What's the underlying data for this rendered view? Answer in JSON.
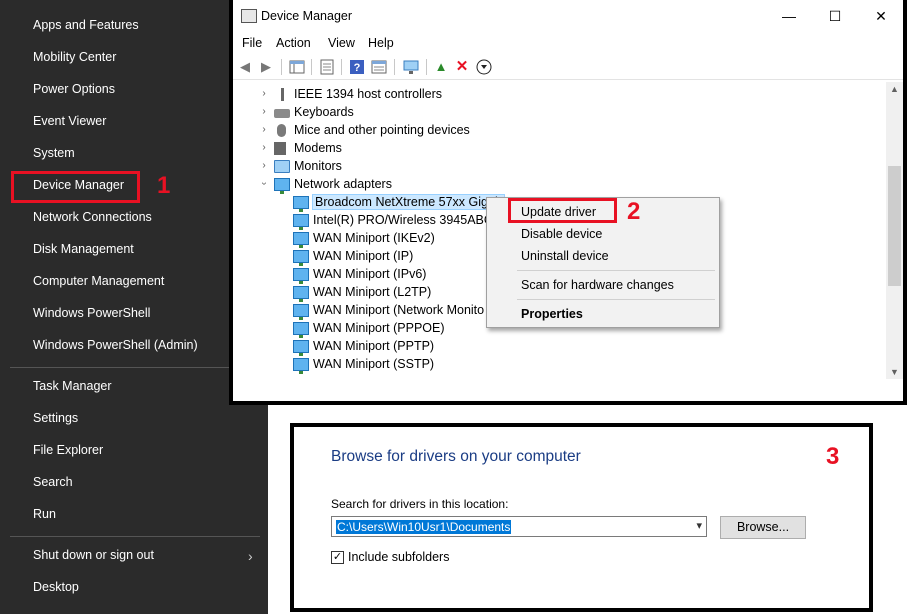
{
  "winx_menu": {
    "items_top": [
      "Apps and Features",
      "Mobility Center",
      "Power Options",
      "Event Viewer",
      "System",
      "Device Manager",
      "Network Connections",
      "Disk Management",
      "Computer Management",
      "Windows PowerShell",
      "Windows PowerShell (Admin)"
    ],
    "items_mid": [
      "Task Manager",
      "Settings",
      "File Explorer",
      "Search",
      "Run"
    ],
    "items_bottom": [
      "Shut down or sign out",
      "Desktop"
    ],
    "submenu_glyph": "›"
  },
  "steps": {
    "one": "1",
    "two": "2",
    "three": "3"
  },
  "device_manager": {
    "title": "Device Manager",
    "window_controls": {
      "minimize": "—",
      "maximize": "☐",
      "close": "✕"
    },
    "menu": [
      "File",
      "Action",
      "View",
      "Help"
    ],
    "tree": {
      "collapsed": [
        "IEEE 1394 host controllers",
        "Keyboards",
        "Mice and other pointing devices",
        "Modems",
        "Monitors"
      ],
      "expanded_category": "Network adapters",
      "adapters": [
        "Broadcom NetXtreme 57xx Gigab",
        "Intel(R) PRO/Wireless 3945ABG N",
        "WAN Miniport (IKEv2)",
        "WAN Miniport (IP)",
        "WAN Miniport (IPv6)",
        "WAN Miniport (L2TP)",
        "WAN Miniport (Network Monito",
        "WAN Miniport (PPPOE)",
        "WAN Miniport (PPTP)",
        "WAN Miniport (SSTP)"
      ]
    },
    "context_menu": [
      "Update driver",
      "Disable device",
      "Uninstall device",
      "Scan for hardware changes",
      "Properties"
    ]
  },
  "browse_dialog": {
    "heading": "Browse for drivers on your computer",
    "search_label": "Search for drivers in this location:",
    "path_value": "C:\\Users\\Win10Usr1\\Documents",
    "browse_button": "Browse...",
    "include_subfolders": "Include subfolders",
    "include_subfolders_checked": true,
    "check_glyph": "✓"
  },
  "colors": {
    "accent_red": "#e81123",
    "menu_bg": "#2b2b2b",
    "selection_blue": "#0078d7",
    "heading_blue": "#1a3c84"
  }
}
